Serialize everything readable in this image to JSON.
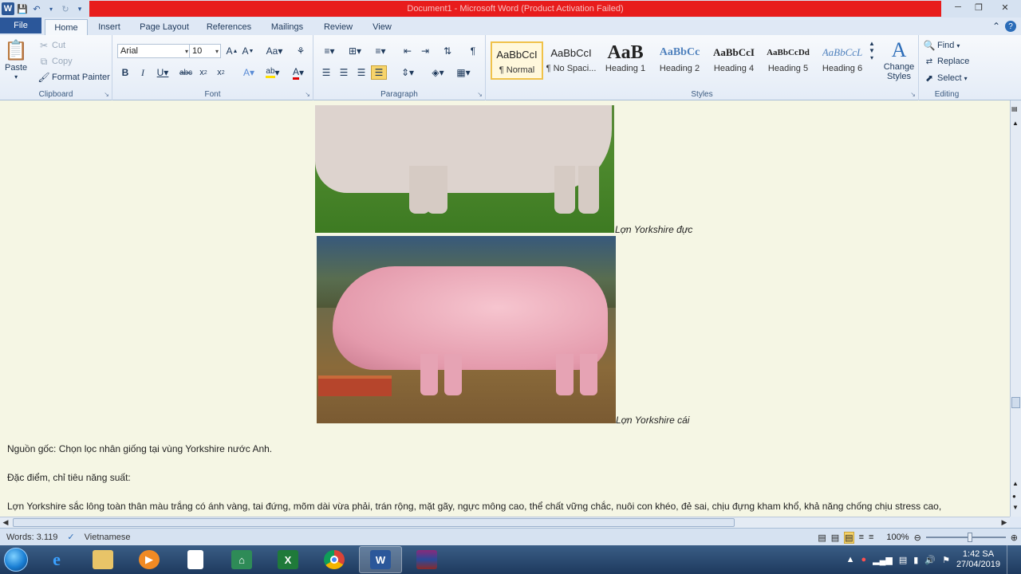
{
  "window": {
    "title": "Document1  -  Microsoft Word (Product Activation Failed)"
  },
  "tabs": [
    {
      "label": "File"
    },
    {
      "label": "Home"
    },
    {
      "label": "Insert"
    },
    {
      "label": "Page Layout"
    },
    {
      "label": "References"
    },
    {
      "label": "Mailings"
    },
    {
      "label": "Review"
    },
    {
      "label": "View"
    }
  ],
  "clipboard": {
    "paste": "Paste",
    "cut": "Cut",
    "copy": "Copy",
    "format_painter": "Format Painter",
    "group_label": "Clipboard"
  },
  "font": {
    "name": "Arial",
    "size": "10",
    "group_label": "Font"
  },
  "paragraph": {
    "group_label": "Paragraph"
  },
  "styles": {
    "items": [
      {
        "preview": "AaBbCcI",
        "name": "¶ Normal"
      },
      {
        "preview": "AaBbCcI",
        "name": "¶ No Spaci..."
      },
      {
        "preview": "AaB",
        "name": "Heading 1"
      },
      {
        "preview": "AaBbCc",
        "name": "Heading 2"
      },
      {
        "preview": "AaBbCcI",
        "name": "Heading 4"
      },
      {
        "preview": "AaBbCcDd",
        "name": "Heading 5"
      },
      {
        "preview": "AaBbCcL",
        "name": "Heading 6"
      }
    ],
    "change_styles": "Change Styles",
    "group_label": "Styles"
  },
  "editing": {
    "find": "Find",
    "replace": "Replace",
    "select": "Select",
    "group_label": "Editing"
  },
  "document": {
    "caption1": "Lợn Yorkshire đực",
    "caption2": "Lợn Yorkshire cái",
    "para1": "Nguồn gốc: Chọn lọc nhân giống tại vùng Yorkshire nước Anh.",
    "para2": "Đặc điểm, chỉ tiêu năng suất:",
    "para3": "Lợn Yorkshire sắc lông toàn thân màu trắng có ánh vàng, tai đứng, mõm dài vừa phải, trán rộng, mặt gãy, ngực mông cao, thể chất vững chắc, nuôi con khéo, đẻ sai, chịu đựng kham khổ, khả năng chống chịu stress cao,"
  },
  "status": {
    "words": "Words: 3.119",
    "language": "Vietnamese",
    "zoom": "100%"
  },
  "taskbar": {
    "time": "1:42 SA",
    "date": "27/04/2019"
  }
}
